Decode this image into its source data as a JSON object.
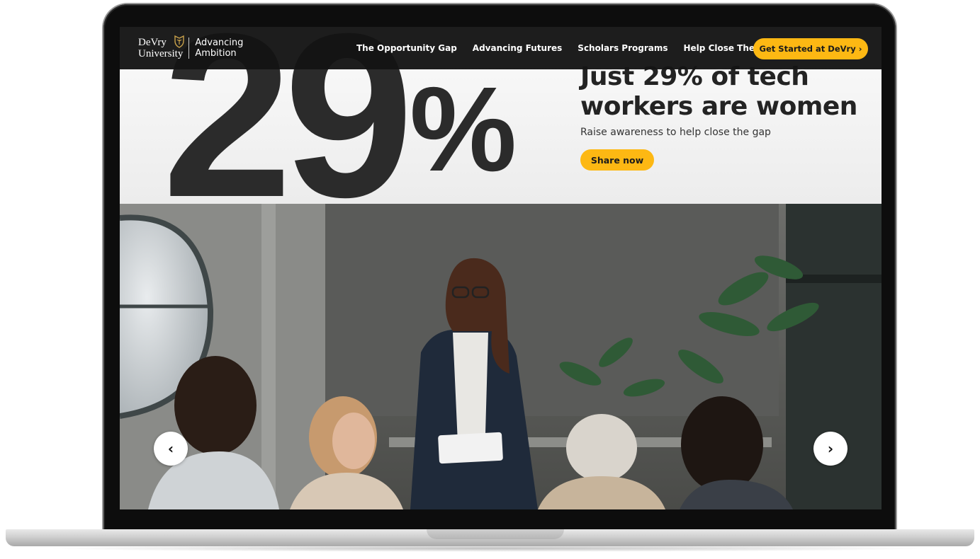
{
  "nav": {
    "logo_line1": "DeVry",
    "logo_line2": "University",
    "tagline_line1": "Advancing",
    "tagline_line2": "Ambition",
    "links": [
      "The Opportunity Gap",
      "Advancing Futures",
      "Scholars Programs",
      "Help Close The Gap"
    ],
    "cta_label": "Get Started at DeVry ›"
  },
  "hero": {
    "big_number": "29",
    "big_symbol": "%",
    "headline": "Just 29% of tech workers are women",
    "subline": "Raise awareness to help close the gap",
    "share_label": "Share now"
  },
  "carousel": {
    "prev_label": "‹",
    "next_label": "›"
  },
  "colors": {
    "accent": "#fdb813",
    "nav_bg": "#141414",
    "text_dark": "#232323"
  }
}
